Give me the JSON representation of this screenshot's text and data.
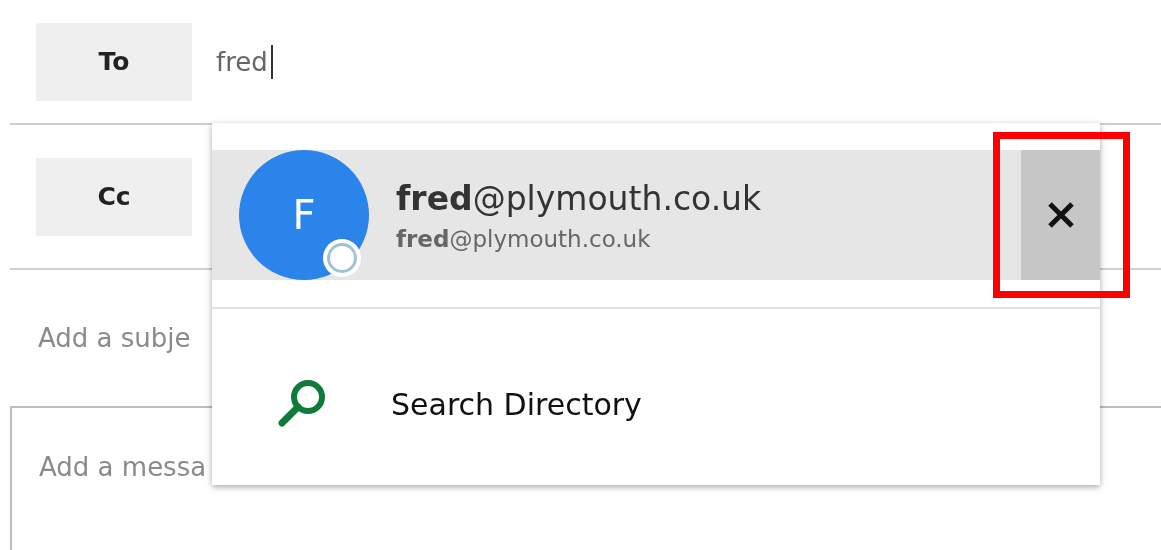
{
  "recipients": [
    {
      "label": "To",
      "value": "fred"
    },
    {
      "label": "Cc"
    }
  ],
  "subject": {
    "placeholder": "Add a subje"
  },
  "message": {
    "placeholder": "Add a messa"
  },
  "suggestions": {
    "items": [
      {
        "initial": "F",
        "name": "**fred**@plymouth.co.uk",
        "email": "**fred**@plymouth.co.uk",
        "selected": true,
        "color": "#2b84ea"
      }
    ],
    "search_label": "Search Directory"
  }
}
